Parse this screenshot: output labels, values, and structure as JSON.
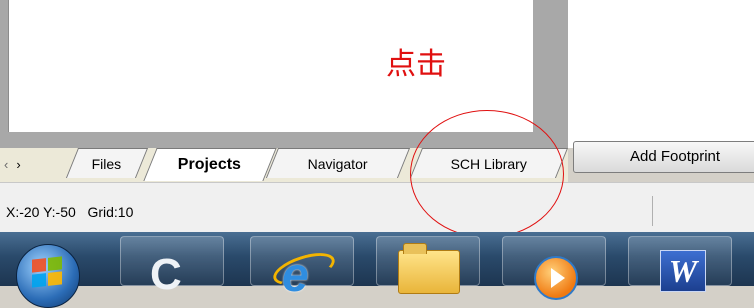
{
  "annotation": {
    "text": "点击"
  },
  "tab_nav": {
    "prev_icon": "‹",
    "next_icon": "›"
  },
  "tabs": [
    {
      "label": "Files",
      "active": false
    },
    {
      "label": "Projects",
      "active": true
    },
    {
      "label": "Navigator",
      "active": false
    },
    {
      "label": "SCH Library",
      "active": false
    }
  ],
  "toolbar": {
    "add_footprint_label": "Add Footprint"
  },
  "status_bar": {
    "coords": "X:-20 Y:-50",
    "grid": "Grid:10"
  },
  "taskbar": {
    "items": [
      {
        "icon": "windows-start-orb-icon"
      },
      {
        "icon": "c-app-icon",
        "glyph": "C"
      },
      {
        "icon": "internet-explorer-icon",
        "glyph": "e"
      },
      {
        "icon": "folder-icon"
      },
      {
        "icon": "media-player-icon"
      },
      {
        "icon": "word-icon",
        "glyph": "W"
      }
    ]
  },
  "colors": {
    "annotation_red": "#e01010",
    "taskbar_blue": "#2a4a6b"
  }
}
